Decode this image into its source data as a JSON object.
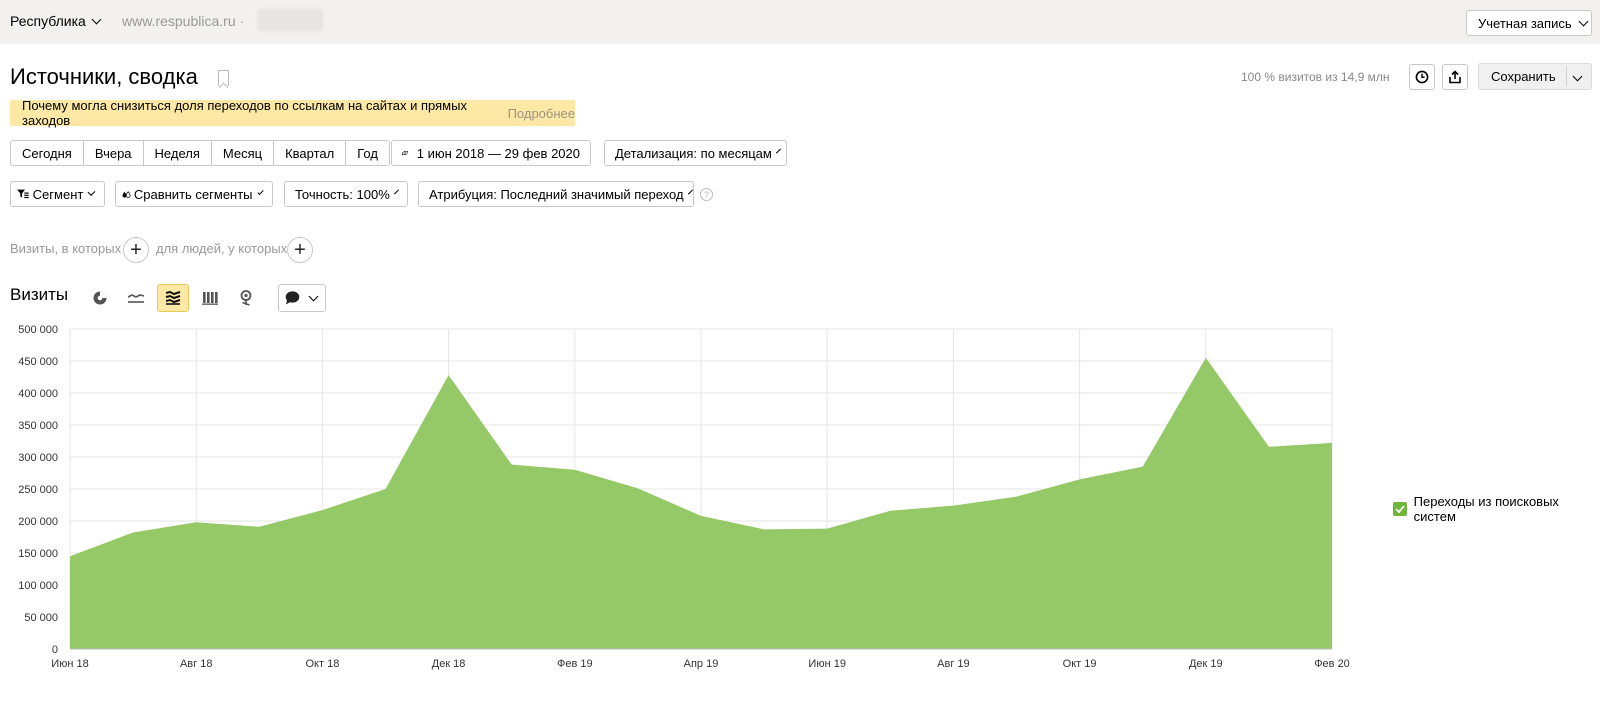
{
  "topbar": {
    "site_name": "Республика",
    "site_url": "www.respublica.ru ·",
    "account_label": "Учетная запись"
  },
  "header": {
    "title": "Источники, сводка",
    "visits_info": "100 % визитов из 14,9 млн",
    "save_label": "Сохранить"
  },
  "notice": {
    "text": "Почему могла снизиться доля переходов по ссылкам на сайтах и прямых заходов",
    "link": "Подробнее"
  },
  "periods": [
    "Сегодня",
    "Вчера",
    "Неделя",
    "Месяц",
    "Квартал",
    "Год"
  ],
  "date_range": "1 июн 2018 — 29 фев 2020",
  "detail": "Детализация: по месяцам",
  "filters": {
    "segment": "Сегмент",
    "compare": "Сравнить сегменты",
    "accuracy": "Точность: 100%",
    "attribution": "Атрибуция: Последний значимый переход",
    "help": "?"
  },
  "conditions": {
    "visits_label": "Визиты, в которых",
    "people_label": "для людей, у которых",
    "plus": "+"
  },
  "chart_section": {
    "title": "Визиты"
  },
  "colors": {
    "area": "#95c867",
    "legend_check": "#6fb63d",
    "notice_bg": "#fde9a5"
  },
  "chart_data": {
    "type": "area",
    "x": [
      "Июн 18",
      "Июл 18",
      "Авг 18",
      "Сен 18",
      "Окт 18",
      "Ноя 18",
      "Дек 18",
      "Янв 19",
      "Фев 19",
      "Мар 19",
      "Апр 19",
      "Май 19",
      "Июн 19",
      "Июл 19",
      "Авг 19",
      "Сен 19",
      "Окт 19",
      "Ноя 19",
      "Дек 19",
      "Янв 20",
      "Фев 20"
    ],
    "x_tick_labels": [
      "Июн 18",
      "Авг 18",
      "Окт 18",
      "Дек 18",
      "Фев 19",
      "Апр 19",
      "Июн 19",
      "Авг 19",
      "Окт 19",
      "Дек 19",
      "Фев 20"
    ],
    "series": [
      {
        "name": "Переходы из поисковых систем",
        "values": [
          145000,
          182000,
          198000,
          191000,
          217000,
          250000,
          428000,
          288000,
          280000,
          251000,
          208000,
          187000,
          188000,
          216000,
          224000,
          238000,
          265000,
          285000,
          455000,
          316000,
          322000
        ]
      }
    ],
    "y_ticks": [
      "0",
      "50 000",
      "100 000",
      "150 000",
      "200 000",
      "250 000",
      "300 000",
      "350 000",
      "400 000",
      "450 000",
      "500 000"
    ],
    "ylim": [
      0,
      500000
    ],
    "grid": true,
    "legend": "right"
  }
}
